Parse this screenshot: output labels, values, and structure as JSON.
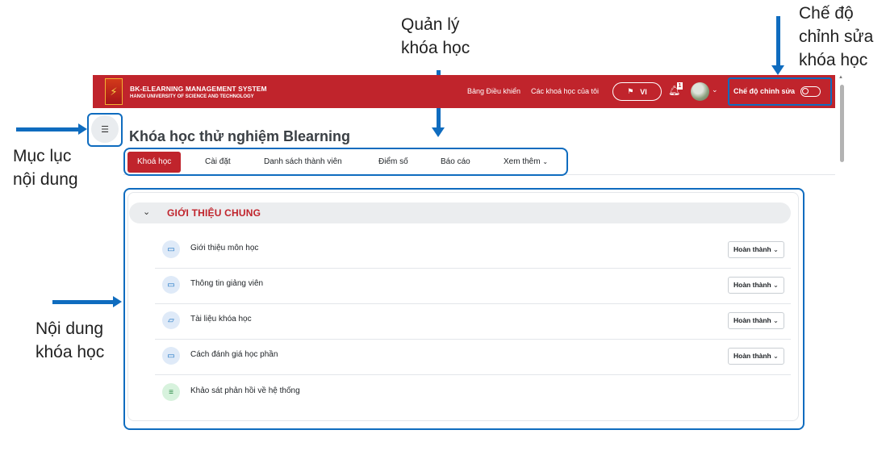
{
  "annotations": {
    "course_mgmt": [
      "Quản lý",
      "khóa học"
    ],
    "edit_mode": [
      "Chế độ",
      "chỉnh sửa",
      "khóa học"
    ],
    "toc": [
      "Mục lục",
      "nội dung"
    ],
    "content": [
      "Nội dung",
      "khóa học"
    ]
  },
  "navbar": {
    "brand_title": "BK-ELEARNING MANAGEMENT SYSTEM",
    "brand_subtitle": "HANOI UNIVERSITY OF SCIENCE AND TECHNOLOGY",
    "dashboard": "Bảng Điều khiển",
    "my_courses": "Các khoá học của tôi",
    "language": "VI",
    "notification_count": "1",
    "edit_mode_label": "Chế độ chỉnh sửa",
    "edit_mode_on": false
  },
  "course": {
    "title": "Khóa học thử nghiệm Blearning",
    "tabs": [
      {
        "label": "Khoá học",
        "active": true
      },
      {
        "label": "Cài đặt"
      },
      {
        "label": "Danh sách thành viên"
      },
      {
        "label": "Điểm số"
      },
      {
        "label": "Báo cáo"
      },
      {
        "label": "Xem thêm"
      }
    ]
  },
  "section": {
    "title": "GIỚI THIỆU CHUNG",
    "activities": [
      {
        "name": "Giới thiệu môn học",
        "icon": "page-icon",
        "status": "Hoàn thành"
      },
      {
        "name": "Thông tin giảng viên",
        "icon": "page-icon",
        "status": "Hoàn thành"
      },
      {
        "name": "Tài liệu khóa học",
        "icon": "folder-icon",
        "status": "Hoàn thành"
      },
      {
        "name": "Cách đánh giá học phần",
        "icon": "page-icon",
        "status": "Hoàn thành"
      },
      {
        "name": "Khảo sát phản hồi về hệ thống",
        "icon": "feedback-icon",
        "status": ""
      }
    ]
  },
  "colors": {
    "brand": "#c0242c",
    "annotation": "#0f6cbf"
  }
}
